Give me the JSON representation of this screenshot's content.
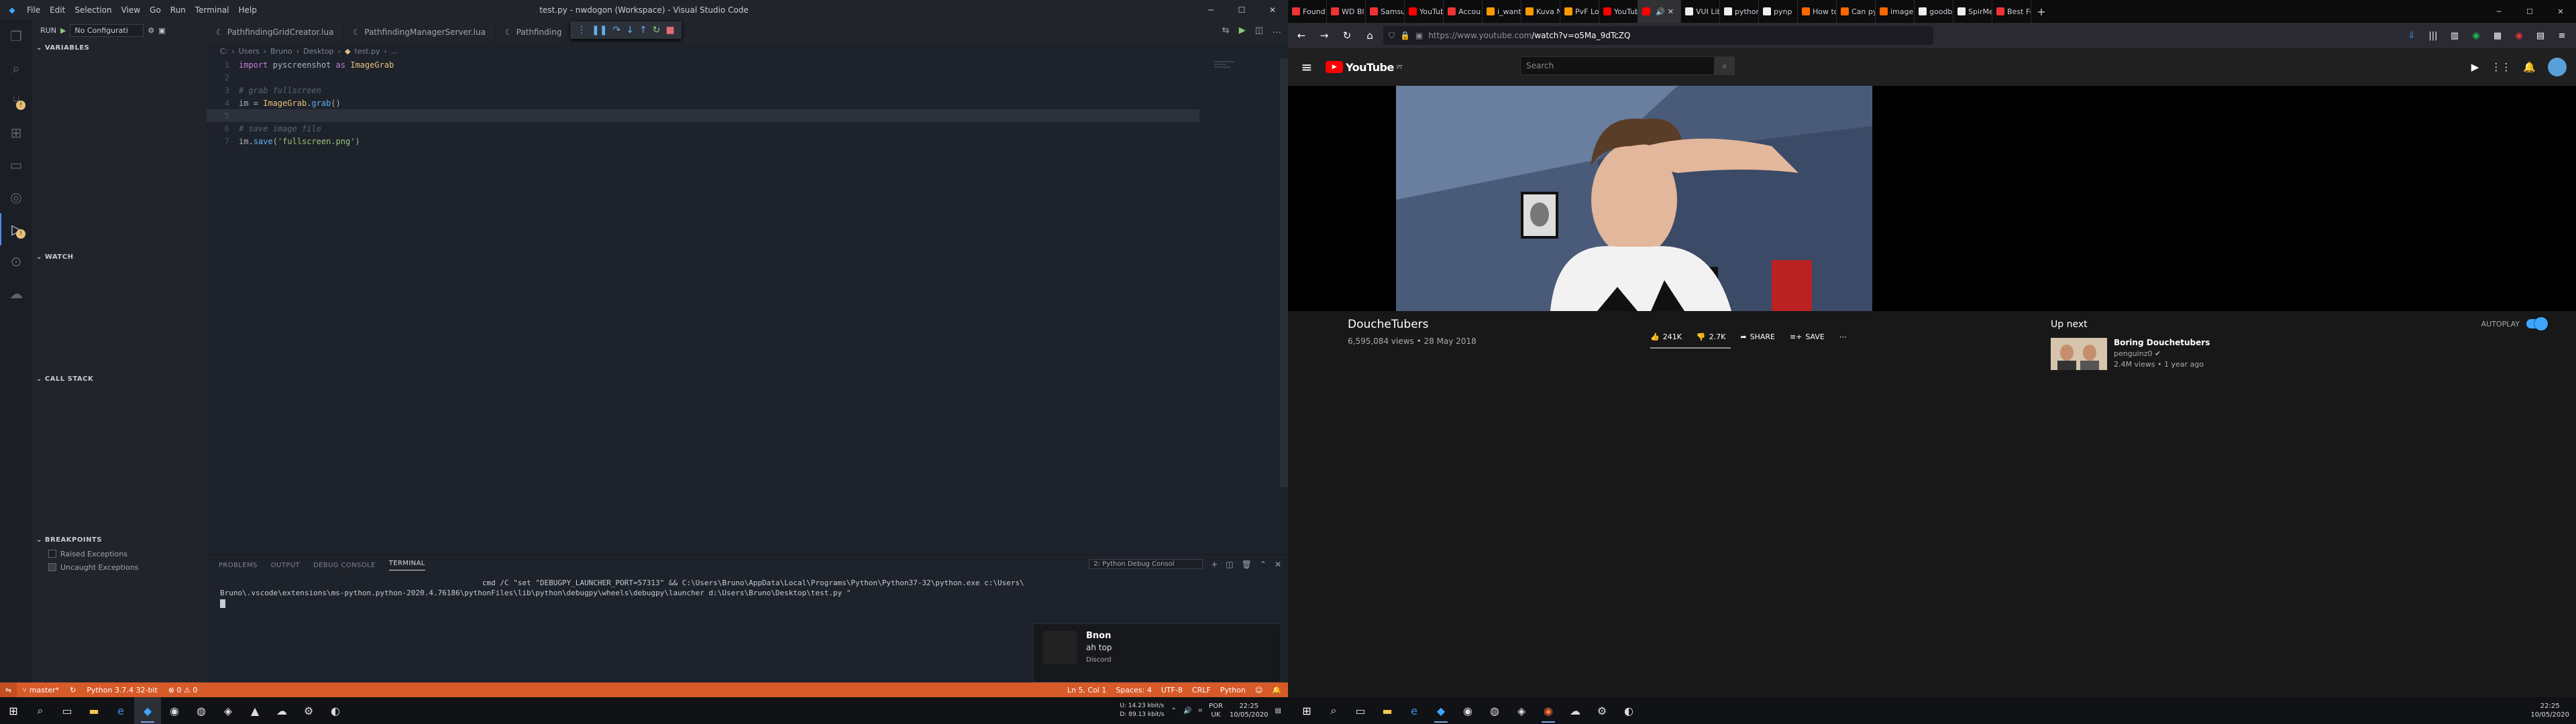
{
  "vscode": {
    "window_title": "test.py - nwdogon (Workspace) - Visual Studio Code",
    "menu": [
      "File",
      "Edit",
      "Selection",
      "View",
      "Go",
      "Run",
      "Terminal",
      "Help"
    ],
    "debug_config": "No Configurati",
    "run_label": "RUN",
    "sections": {
      "variables": "VARIABLES",
      "watch": "WATCH",
      "call_stack": "CALL STACK",
      "breakpoints": "BREAKPOINTS"
    },
    "breakpoints": [
      {
        "label": "Raised Exceptions",
        "checked": false
      },
      {
        "label": "Uncaught Exceptions",
        "checked": true
      }
    ],
    "tabs": [
      "PathfindingGridCreator.lua",
      "PathfindingManagerServer.lua",
      "Pathfinding"
    ],
    "breadcrumb": [
      "C:",
      "Users",
      "Bruno",
      "Desktop",
      "test.py",
      "..."
    ],
    "code": [
      {
        "n": "1",
        "kind": "import",
        "kw": "import",
        "mod": "pyscreenshot",
        "as": "as",
        "alias": "ImageGrab"
      },
      {
        "n": "2",
        "kind": "blank"
      },
      {
        "n": "3",
        "kind": "comment",
        "text": "# grab fullscreen"
      },
      {
        "n": "4",
        "kind": "assign",
        "text1": "im = ",
        "cls": "ImageGrab",
        "dot": ".",
        "fn": "grab",
        "text2": "()"
      },
      {
        "n": "5",
        "kind": "blank"
      },
      {
        "n": "6",
        "kind": "comment",
        "text": "# save image file"
      },
      {
        "n": "7",
        "kind": "save",
        "text1": "im.",
        "fn": "save",
        "text2": "(",
        "str": "'fullscreen.png'",
        "text3": ")"
      }
    ],
    "panel_tabs": [
      "PROBLEMS",
      "OUTPUT",
      "DEBUG CONSOLE",
      "TERMINAL"
    ],
    "terminal_select": "2: Python Debug Consol",
    "terminal_lines": [
      "                                                           cmd /C \"set \"DEBUGPY_LAUNCHER_PORT=57313\" && C:\\Users\\Bruno\\AppData\\Local\\Programs\\Python\\Python37-32\\python.exe c:\\Users\\",
      "Bruno\\.vscode\\extensions\\ms-python.python-2020.4.76186\\pythonFiles\\lib\\python\\debugpy\\wheels\\debugpy\\launcher d:\\Users\\Bruno\\Desktop\\test.py \""
    ],
    "status": {
      "branch": "master*",
      "python": "Python 3.7.4 32-bit",
      "problems": "⊗ 0  ⚠ 0",
      "position": "Ln 5, Col 1",
      "spaces": "Spaces: 4",
      "encoding": "UTF-8",
      "eol": "CRLF",
      "lang": "Python"
    },
    "notification": {
      "title": "Bnon",
      "message": "ah top",
      "app": "Discord"
    }
  },
  "taskbar_left": {
    "net_up": "14.23 kbit/s",
    "net_down": "89.13 kbit/s",
    "net_up_label": "U:",
    "net_down_label": "D:",
    "lang": "POR",
    "region": "UK",
    "time": "22:25",
    "date": "10/05/2020"
  },
  "browser": {
    "tabs": [
      {
        "label": "Found",
        "color": "#e33"
      },
      {
        "label": "WD Bl",
        "color": "#e33"
      },
      {
        "label": "Samsun",
        "color": "#e33"
      },
      {
        "label": "YouTub",
        "color": "#f00"
      },
      {
        "label": "Accou",
        "color": "#e33"
      },
      {
        "label": "i_want",
        "color": "#f90"
      },
      {
        "label": "Kuva N",
        "color": "#f90"
      },
      {
        "label": "PvF Lo",
        "color": "#f90"
      },
      {
        "label": "YouTube",
        "color": "#f00"
      },
      {
        "label": "",
        "color": "#f00",
        "active": true
      },
      {
        "label": "VUI Lib",
        "color": "#eee"
      },
      {
        "label": "python",
        "color": "#eee"
      },
      {
        "label": "pynp",
        "color": "#eee"
      },
      {
        "label": "How to",
        "color": "#f60"
      },
      {
        "label": "Can py",
        "color": "#f60"
      },
      {
        "label": "image",
        "color": "#f60"
      },
      {
        "label": "goodbi",
        "color": "#eee"
      },
      {
        "label": "SpirMe",
        "color": "#eee"
      },
      {
        "label": "Best Fo",
        "color": "#e33"
      }
    ],
    "url_host": "https://www.youtube.com",
    "url_path": "/watch?v=o5Ma_9dTcZQ",
    "yt": {
      "logo": "YouTube",
      "logo_region": "PT",
      "search_placeholder": "Search",
      "video_title": "DoucheTubers",
      "meta": "6,595,084 views • 28 May 2018",
      "likes": "241K",
      "dislikes": "2.7K",
      "share": "SHARE",
      "save": "SAVE",
      "up_next": "Up next",
      "autoplay": "AUTOPLAY",
      "rec_title": "Boring Douchetubers",
      "rec_channel": "penguinz0",
      "rec_meta": "2.4M views • 1 year ago"
    }
  },
  "taskbar_right": {
    "time": "22:25",
    "date": "10/05/2020"
  }
}
